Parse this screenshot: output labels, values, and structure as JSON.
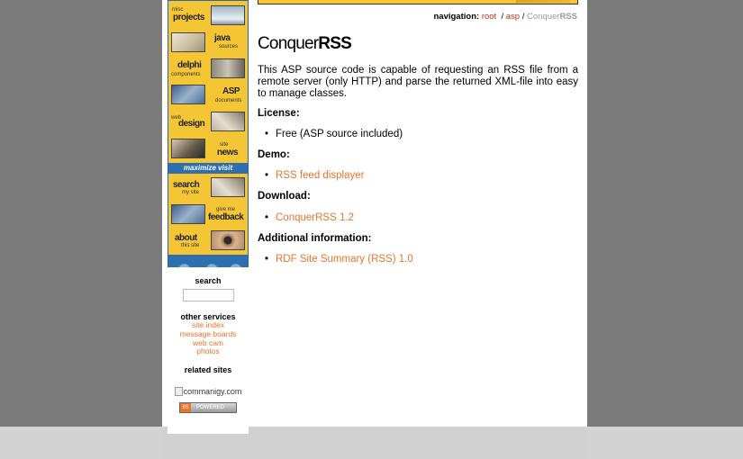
{
  "navigation": {
    "label": "navigation:",
    "root": "root",
    "asp": "asp",
    "separator": "/",
    "current_prefix": "Conquer",
    "current_suffix": "RSS"
  },
  "nav_tiles": [
    {
      "small": "misc",
      "big": "projects"
    },
    {
      "small": "sources",
      "big": "java"
    },
    {
      "small": "components",
      "big": "delphi"
    },
    {
      "small": "documents",
      "big": "ASP"
    },
    {
      "small": "web",
      "big": "design"
    },
    {
      "small": "site",
      "big": "news"
    },
    {
      "small": "my site",
      "big": "search"
    },
    {
      "small": "give me",
      "big": "feedback"
    },
    {
      "small": "this site",
      "big": "about"
    }
  ],
  "banner_text": "maximize visit",
  "sidebar": {
    "search_heading": "search",
    "search_value": "",
    "other_services_heading": "other services",
    "services": [
      "site index",
      "message boards",
      "web cam",
      "photos"
    ],
    "related_heading": "related sites",
    "related_site": "commanigy.com",
    "powered_badge": "IIS",
    "powered_text": "POWERED"
  },
  "main": {
    "title_light": "Conquer",
    "title_bold": "RSS",
    "description": "This ASP source code is capable of requesting an RSS file from a remote server (only HTTP) and parse the returned XML-file into easy to manage classes.",
    "license_heading": "License:",
    "license_item": "Free (ASP source included)",
    "demo_heading": "Demo:",
    "demo_link": "RSS feed displayer",
    "download_heading": "Download:",
    "download_link": "ConquerRSS 1.2",
    "additional_heading": "Additional information:",
    "additional_link": "RDF Site Summary (RSS) 1.0"
  },
  "colors": {
    "link": "#e8742a",
    "breadcrumb_link": "#c0311a",
    "sidebar_yellow": "#f4c534",
    "sidebar_blue": "#2f6fb0"
  }
}
